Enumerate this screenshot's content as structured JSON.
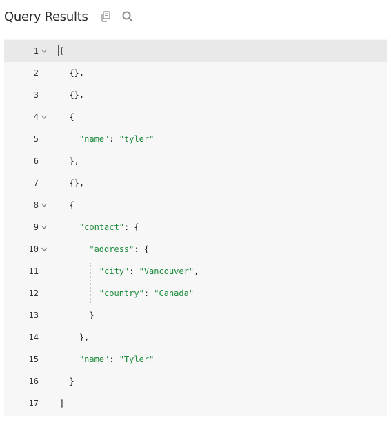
{
  "header": {
    "title": "Query Results",
    "copy_icon": "copy-icon",
    "search_icon": "search-icon"
  },
  "colors": {
    "key": "#1a8a3a",
    "string": "#1a8a3a",
    "editor_bg": "#f7f7f7",
    "active_line": "#e9e9e9"
  },
  "lines": [
    {
      "num": "1",
      "fold": true,
      "text": "["
    },
    {
      "num": "2",
      "fold": false,
      "text": "  {},"
    },
    {
      "num": "3",
      "fold": false,
      "text": "  {},"
    },
    {
      "num": "4",
      "fold": true,
      "text": "  {"
    },
    {
      "num": "5",
      "fold": false,
      "text": "    \"name\": \"tyler\""
    },
    {
      "num": "6",
      "fold": false,
      "text": "  },"
    },
    {
      "num": "7",
      "fold": false,
      "text": "  {},"
    },
    {
      "num": "8",
      "fold": true,
      "text": "  {"
    },
    {
      "num": "9",
      "fold": true,
      "text": "    \"contact\": {"
    },
    {
      "num": "10",
      "fold": true,
      "text": "      \"address\": {"
    },
    {
      "num": "11",
      "fold": false,
      "text": "        \"city\": \"Vancouver\","
    },
    {
      "num": "12",
      "fold": false,
      "text": "        \"country\": \"Canada\""
    },
    {
      "num": "13",
      "fold": false,
      "text": "      }"
    },
    {
      "num": "14",
      "fold": false,
      "text": "    },"
    },
    {
      "num": "15",
      "fold": false,
      "text": "    \"name\": \"Tyler\""
    },
    {
      "num": "16",
      "fold": false,
      "text": "  }"
    },
    {
      "num": "17",
      "fold": false,
      "text": "]"
    }
  ]
}
